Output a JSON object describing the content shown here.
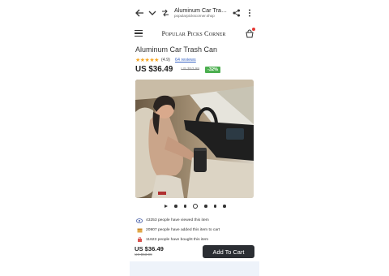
{
  "browser": {
    "tab_title": "Aluminum Car Trash C...",
    "domain": "popularpickscorner.shop"
  },
  "site": {
    "brand": "Popular Picks Corner"
  },
  "product": {
    "title": "Aluminum Car Trash Can",
    "stars": "★★★★★",
    "rating": "(4.9)",
    "reviews": "64 reviews",
    "price": "US $36.49",
    "old_price": "US $53.99",
    "discount": "-32%"
  },
  "carousel": {
    "slides": 6,
    "active_index": 2
  },
  "stats": [
    {
      "icon": "eye-icon",
      "text": "43253 people have viewed this item"
    },
    {
      "icon": "box-icon",
      "text": "20907 people have added this item to cart"
    },
    {
      "icon": "bag-icon",
      "text": "11623 people have bought this item"
    }
  ],
  "bottom_bar": {
    "price": "US $36.49",
    "old_price": "US $53.99",
    "add_to_cart": "Add To Cart"
  },
  "colors": {
    "discount_badge": "#4caf50",
    "star": "#f5a623",
    "link": "#3b66c4",
    "cart_button": "#2b2e33",
    "cart_badge": "#e53935"
  }
}
